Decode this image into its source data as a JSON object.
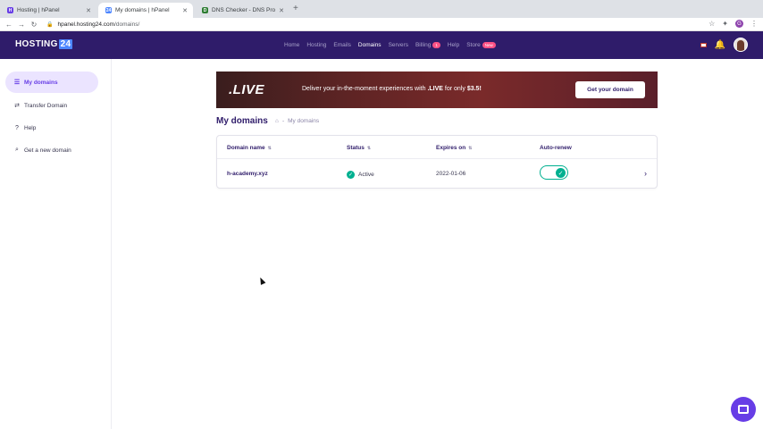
{
  "browser": {
    "tabs": [
      {
        "title": "Hosting | hPanel",
        "favicon": "hostinger-icon",
        "favicon_color": "#673de6"
      },
      {
        "title": "My domains | hPanel",
        "favicon": "hosting24-icon",
        "favicon_color": "#4d86ff"
      },
      {
        "title": "DNS Checker - DNS Propagatio",
        "favicon": "dnschecker-icon",
        "favicon_color": "#2e7d32"
      }
    ],
    "url_host": "hpanel.hosting24.com",
    "url_path": "/domains/",
    "profile_initial": "G"
  },
  "header": {
    "logo_text": "HOSTING",
    "logo_num": "24",
    "nav": [
      {
        "label": "Home"
      },
      {
        "label": "Hosting"
      },
      {
        "label": "Emails"
      },
      {
        "label": "Domains"
      },
      {
        "label": "Servers"
      },
      {
        "label": "Billing",
        "badge": "1",
        "badge_color": "#fc5185"
      },
      {
        "label": "Help"
      },
      {
        "label": "Store",
        "badge": "New",
        "badge_color": "#fc5185"
      }
    ],
    "active_nav": "Domains"
  },
  "sidebar": {
    "items": [
      {
        "label": "My domains",
        "icon": "list-icon"
      },
      {
        "label": "Transfer Domain",
        "icon": "transfer-icon"
      },
      {
        "label": "Help",
        "icon": "help-icon"
      },
      {
        "label": "Get a new domain",
        "icon": "search-icon"
      }
    ]
  },
  "banner": {
    "logo": ".LIVE",
    "text_pre": "Deliver your in-the-moment experiences with ",
    "text_bold": ".LIVE",
    "text_mid": " for only ",
    "text_price": "$3.5!",
    "button": "Get your domain"
  },
  "page": {
    "title": "My domains",
    "breadcrumb_sep": "-",
    "breadcrumb": "My domains"
  },
  "table": {
    "columns": [
      "Domain name",
      "Status",
      "Expires on",
      "Auto-renew"
    ],
    "rows": [
      {
        "domain": "h-academy.xyz",
        "status": "Active",
        "expires": "2022-01-06",
        "auto_renew": true
      }
    ]
  },
  "colors": {
    "header_bg": "#2f1c6a",
    "accent": "#673de6",
    "success": "#00b090"
  }
}
